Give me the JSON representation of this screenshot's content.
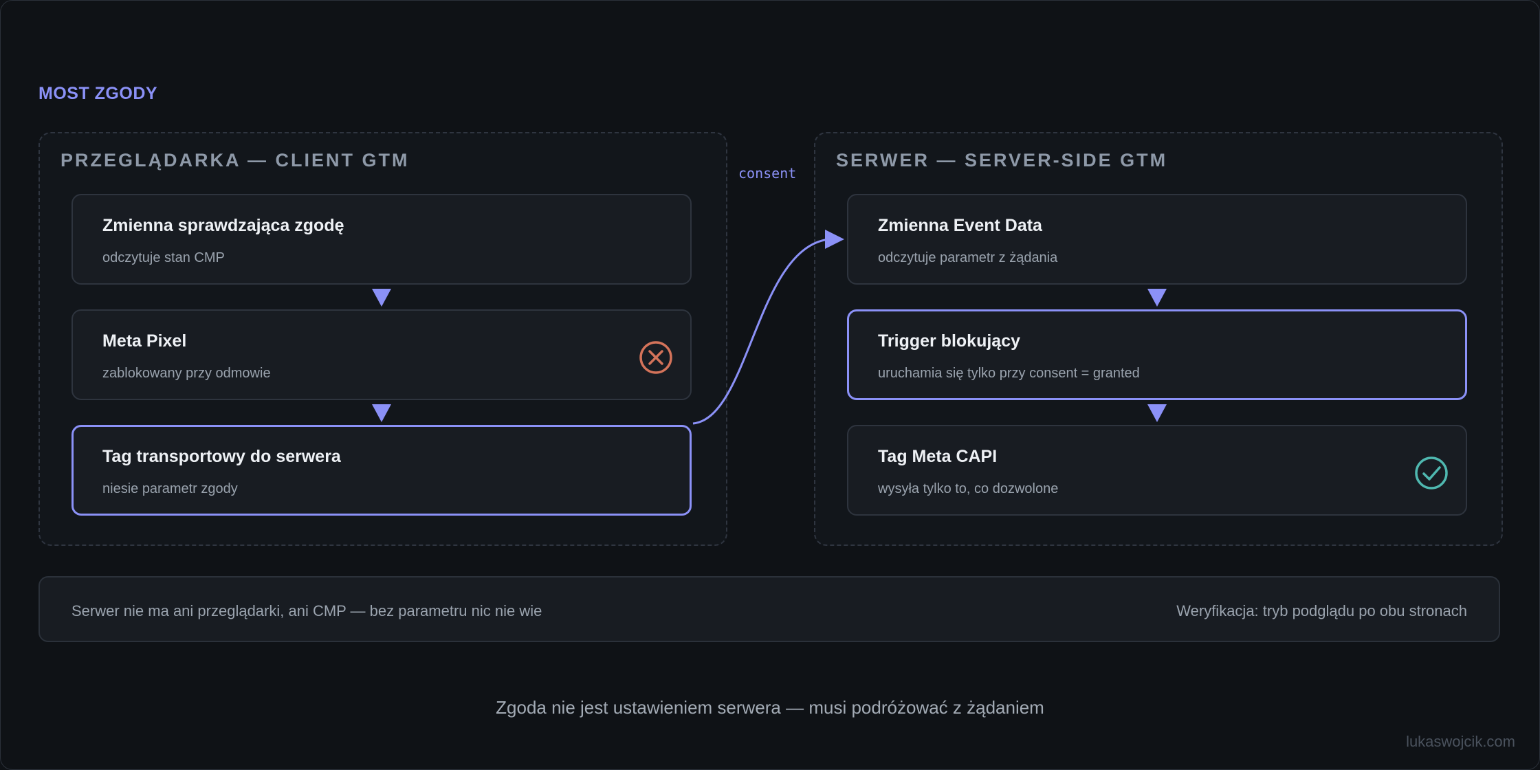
{
  "diagram": {
    "title": "MOST ZGODY",
    "connector_label": "consent",
    "accent_color": "#8b91f7",
    "left_panel": {
      "title": "PRZEGLĄDARKA — CLIENT GTM",
      "nodes": [
        {
          "title": "Zmienna sprawdzająca zgodę",
          "subtitle": "odczytuje stan CMP"
        },
        {
          "title": "Meta Pixel",
          "subtitle": "zablokowany przy odmowie",
          "status_icon": "blocked-x-icon",
          "status_color": "#d4735a"
        },
        {
          "title": "Tag transportowy do serwera",
          "subtitle": "niesie parametr zgody",
          "highlighted": true
        }
      ]
    },
    "right_panel": {
      "title": "SERWER — SERVER-SIDE GTM",
      "nodes": [
        {
          "title": "Zmienna Event Data",
          "subtitle": "odczytuje parametr z żądania"
        },
        {
          "title": "Trigger blokujący",
          "subtitle": "uruchamia się tylko przy consent = granted",
          "highlighted": true
        },
        {
          "title": "Tag Meta CAPI",
          "subtitle": "wysyła tylko to, co dozwolone",
          "status_icon": "check-circle-icon",
          "status_color": "#4fb8b0"
        }
      ]
    },
    "info_bar": {
      "left": "Serwer nie ma ani przeglądarki, ani CMP — bez parametru nic nie wie",
      "right": "Weryfikacja: tryb podglądu po obu stronach"
    },
    "footer": "Zgoda nie jest ustawieniem serwera — musi podróżować z żądaniem",
    "watermark": "lukaswojcik.com"
  }
}
